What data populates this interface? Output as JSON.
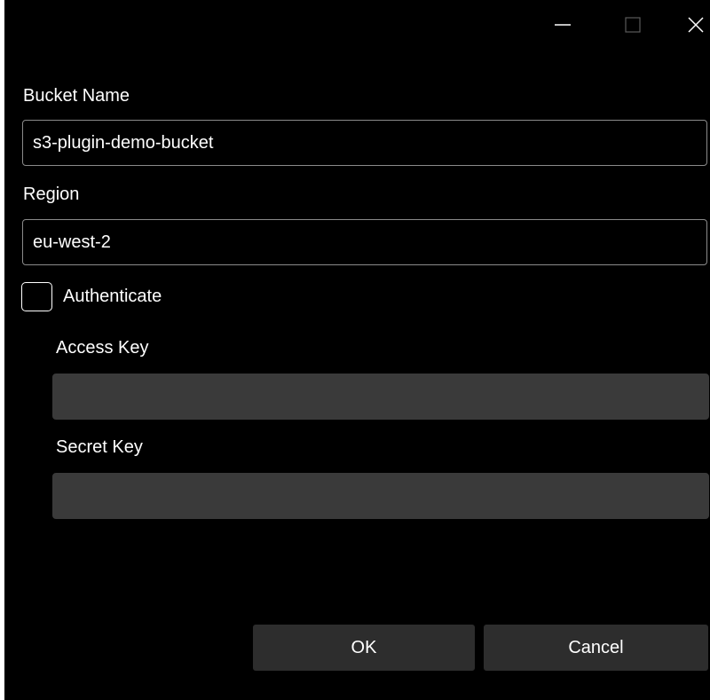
{
  "window": {
    "controls": {
      "minimize_icon": "minimize-icon",
      "maximize_icon": "maximize-icon",
      "close_icon": "close-icon"
    }
  },
  "form": {
    "bucket_name": {
      "label": "Bucket Name",
      "value": "s3-plugin-demo-bucket"
    },
    "region": {
      "label": "Region",
      "value": "eu-west-2"
    },
    "authenticate": {
      "label": "Authenticate",
      "checked": false
    },
    "access_key": {
      "label": "Access Key",
      "value": ""
    },
    "secret_key": {
      "label": "Secret Key",
      "value": ""
    }
  },
  "buttons": {
    "ok_label": "OK",
    "cancel_label": "Cancel"
  },
  "colors": {
    "background": "#000000",
    "input_border": "#8a8a8a",
    "disabled_input": "#3a3a3a",
    "button": "#2d2d2d",
    "text": "#ffffff"
  }
}
